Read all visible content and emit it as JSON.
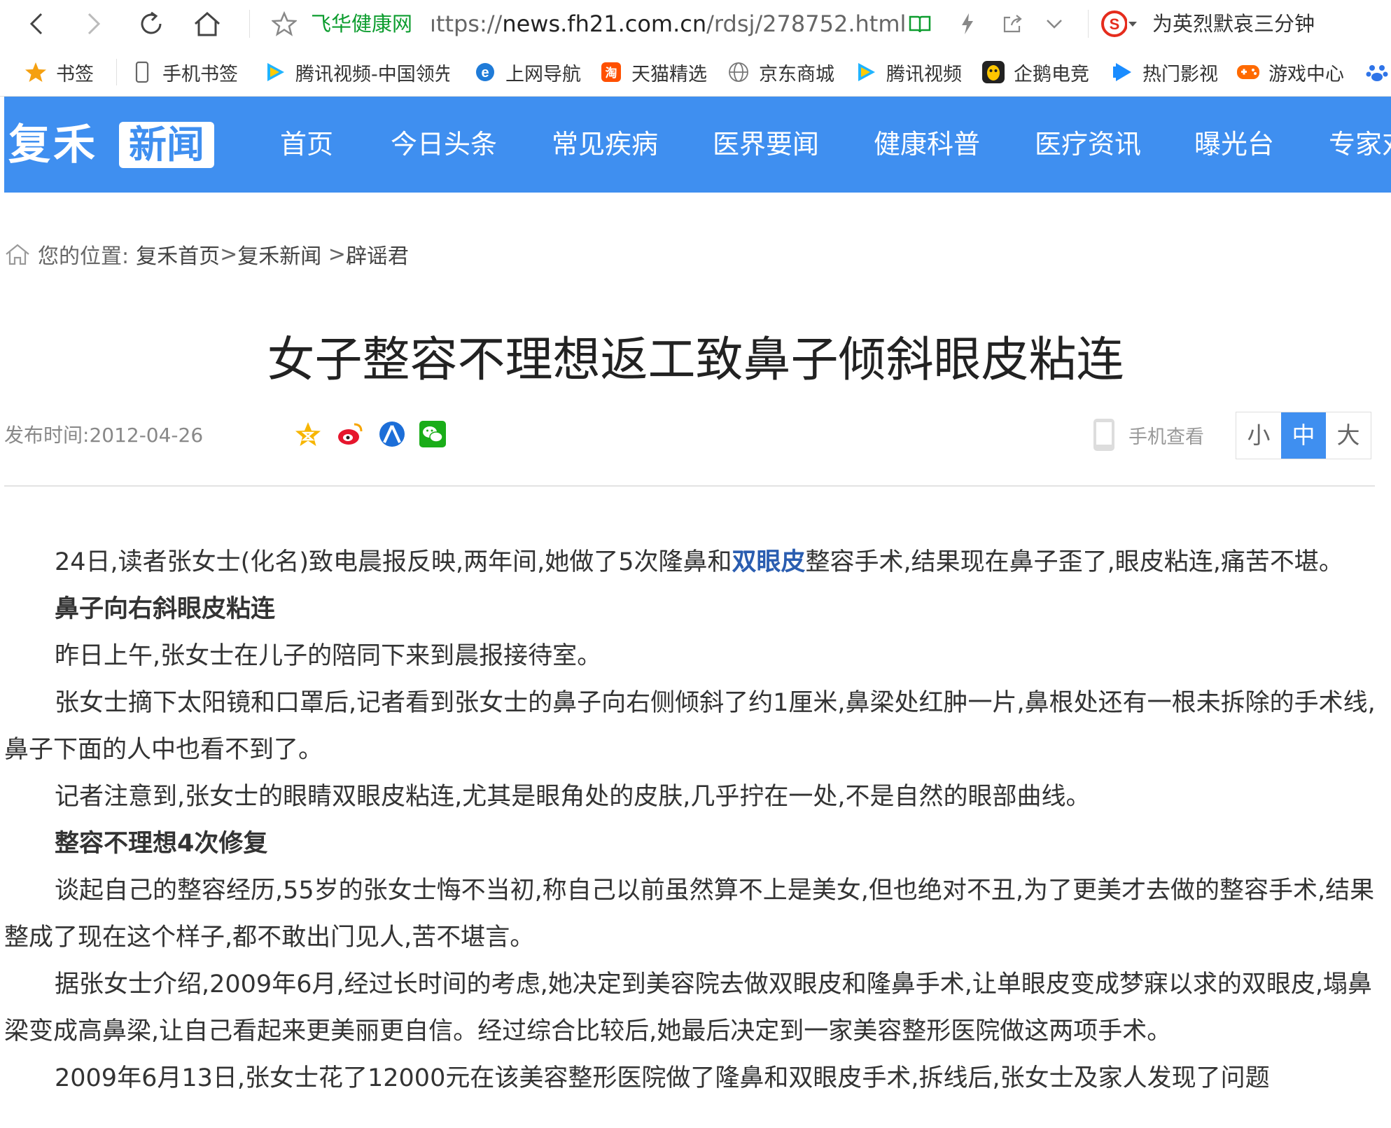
{
  "browser": {
    "site_name": "飞华健康网",
    "url_prefix": "ıttps://",
    "url_main": "news.fh21.com.cn",
    "url_path": "/rdsj/278752.html",
    "search_hint": "为英烈默哀三分钟"
  },
  "bookmarks": [
    {
      "label": "书签",
      "icon": "star-icon"
    },
    {
      "label": "手机书签",
      "icon": "phone-icon"
    },
    {
      "label": "腾讯视频-中国领先",
      "icon": "tencent-video-icon"
    },
    {
      "label": "上网导航",
      "icon": "ie-icon"
    },
    {
      "label": "天猫精选",
      "icon": "tmall-icon"
    },
    {
      "label": "京东商城",
      "icon": "globe-icon"
    },
    {
      "label": "腾讯视频",
      "icon": "tencent-video-icon"
    },
    {
      "label": "企鹅电竞",
      "icon": "penguin-icon"
    },
    {
      "label": "热门影视",
      "icon": "play-icon"
    },
    {
      "label": "游戏中心",
      "icon": "gamepad-icon"
    }
  ],
  "site": {
    "logo_a": "复禾",
    "logo_b": "新闻",
    "nav": [
      "首页",
      "今日头条",
      "常见疾病",
      "医界要闻",
      "健康科普",
      "医疗资讯",
      "曝光台",
      "专家对"
    ]
  },
  "breadcrumb": {
    "prefix": "您的位置:",
    "items": [
      "复禾首页",
      "复禾新闻",
      "辟谣君"
    ],
    "sep1": ">",
    "sep2": " >"
  },
  "article": {
    "title": "女子整容不理想返工致鼻子倾斜眼皮粘连",
    "pub_label": "发布时间:",
    "pub_date": "2012-04-26",
    "mobile_view": "手机查看",
    "font_sizes": [
      "小",
      "中",
      "大"
    ],
    "p1_a": "24日,读者张女士(化名)致电晨报反映,两年间,她做了5次隆鼻和",
    "p1_kw": "双眼皮",
    "p1_b": "整容手术,结果现在鼻子歪了,眼皮粘连,痛苦不堪。",
    "h1": "鼻子向右斜眼皮粘连",
    "p2": "昨日上午,张女士在儿子的陪同下来到晨报接待室。",
    "p3": "张女士摘下太阳镜和口罩后,记者看到张女士的鼻子向右侧倾斜了约1厘米,鼻梁处红肿一片,鼻根处还有一根未拆除的手术线,鼻子下面的人中也看不到了。",
    "p4": "记者注意到,张女士的眼睛双眼皮粘连,尤其是眼角处的皮肤,几乎拧在一处,不是自然的眼部曲线。",
    "h2": "整容不理想4次修复",
    "p5": "谈起自己的整容经历,55岁的张女士悔不当初,称自己以前虽然算不上是美女,但也绝对不丑,为了更美才去做的整容手术,结果整成了现在这个样子,都不敢出门见人,苦不堪言。",
    "p6": "据张女士介绍,2009年6月,经过长时间的考虑,她决定到美容院去做双眼皮和隆鼻手术,让单眼皮变成梦寐以求的双眼皮,塌鼻梁变成高鼻梁,让自己看起来更美丽更自信。经过综合比较后,她最后决定到一家美容整形医院做这两项手术。",
    "p7": "2009年6月13日,张女士花了12000元在该美容整形医院做了隆鼻和双眼皮手术,拆线后,张女士及家人发现了问题"
  }
}
